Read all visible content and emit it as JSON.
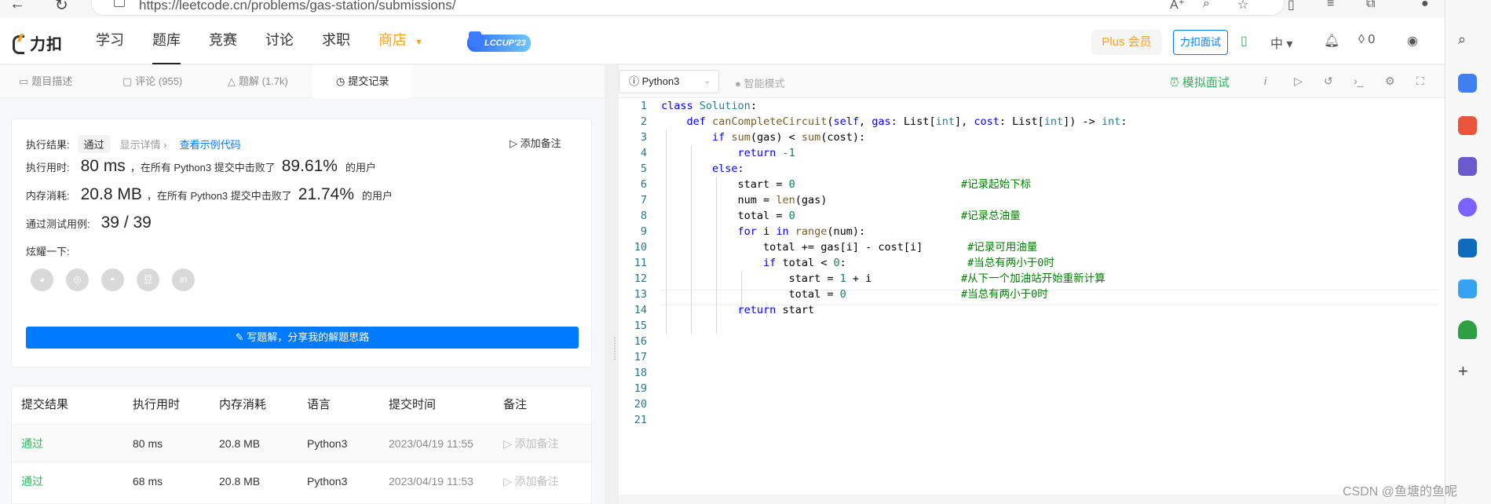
{
  "browser": {
    "url": "https://leetcode.cn/problems/gas-station/submissions/"
  },
  "header": {
    "logo_text": "力扣",
    "nav": [
      "学习",
      "题库",
      "竞赛",
      "讨论",
      "求职",
      "商店"
    ],
    "lccup": "LCCUP'23",
    "plus": "Plus 会员",
    "mock_btn": "力扣面试",
    "lang_switch": "中",
    "points": "0"
  },
  "tabs": [
    {
      "label": "题目描述"
    },
    {
      "label": "评论 (955)"
    },
    {
      "label": "题解 (1.7k)"
    },
    {
      "label": "提交记录"
    }
  ],
  "result": {
    "label": "执行结果:",
    "status": "通过",
    "details": "显示详情 ›",
    "example": "查看示例代码",
    "add_note": "添加备注",
    "runtime_label": "执行用时:",
    "runtime_value": "80 ms",
    "runtime_mid": "，在所有 Python3 提交中击败了",
    "runtime_pct": "89.61%",
    "users": "的用户",
    "memory_label": "内存消耗:",
    "memory_value": "20.8 MB",
    "memory_mid": "，在所有 Python3 提交中击败了",
    "memory_pct": "21.74%",
    "tests_label": "通过测试用例:",
    "tests_value": "39 / 39",
    "share_label": "炫耀一下:",
    "write_btn": "写题解，分享我的解题思路"
  },
  "table": {
    "headers": [
      "提交结果",
      "执行用时",
      "内存消耗",
      "语言",
      "提交时间",
      "备注"
    ],
    "rows": [
      {
        "result": "通过",
        "time": "80 ms",
        "mem": "20.8 MB",
        "lang": "Python3",
        "date": "2023/04/19 11:55",
        "note": "添加备注"
      },
      {
        "result": "通过",
        "time": "68 ms",
        "mem": "20.8 MB",
        "lang": "Python3",
        "date": "2023/04/19 11:53",
        "note": "添加备注"
      }
    ]
  },
  "editor": {
    "language": "Python3",
    "smart": "智能模式",
    "mock": "模拟面试",
    "line_numbers": [
      "1",
      "2",
      "3",
      "4",
      "5",
      "6",
      "7",
      "8",
      "9",
      "10",
      "11",
      "12",
      "13",
      "14",
      "15",
      "16",
      "17",
      "18",
      "19",
      "20",
      "21"
    ]
  },
  "watermark": "CSDN @鱼塘的鱼呢"
}
